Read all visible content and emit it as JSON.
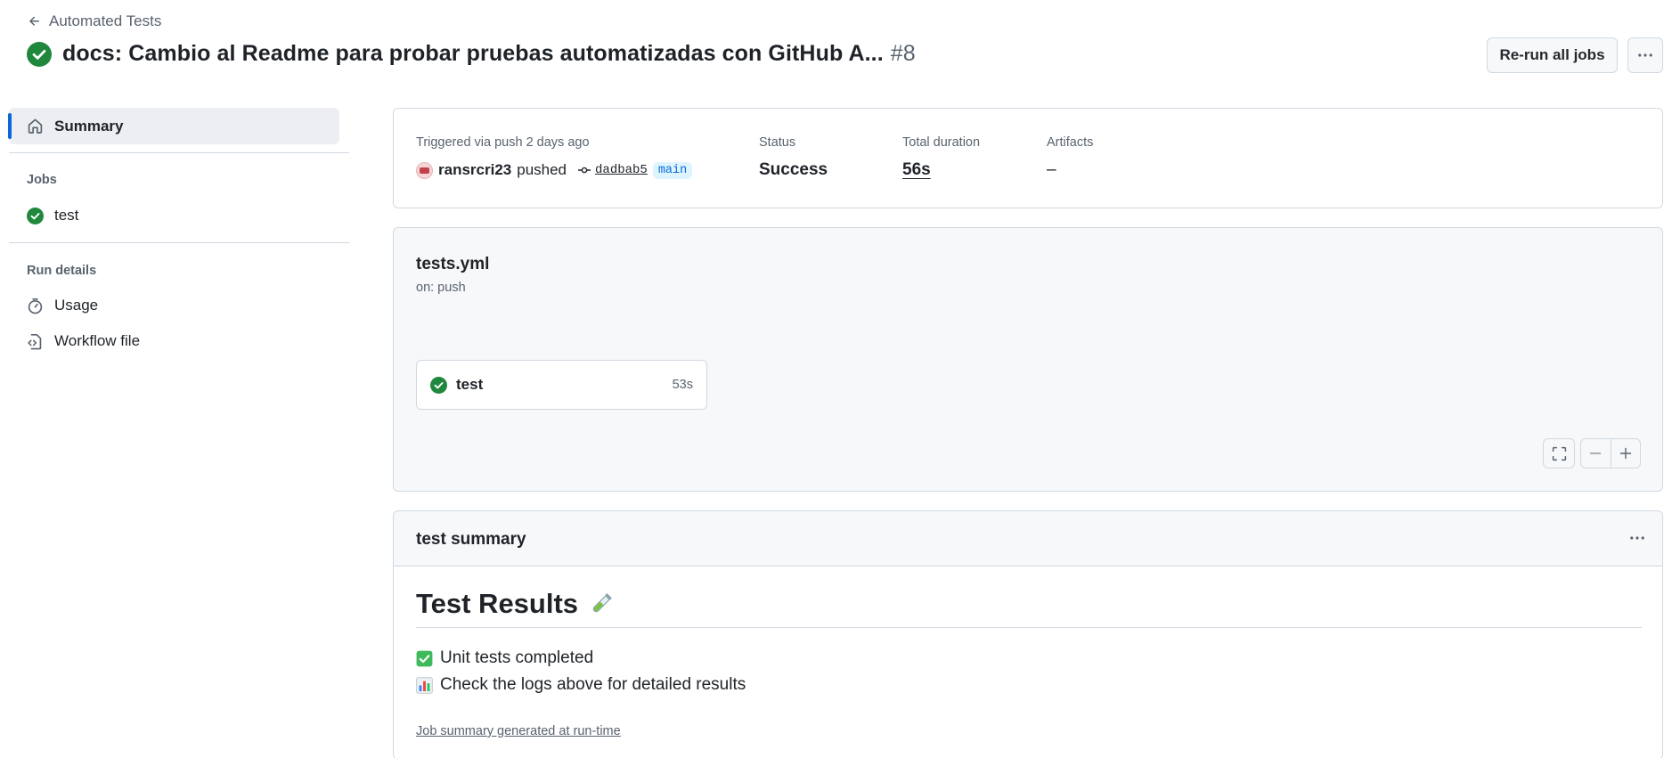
{
  "header": {
    "back_label": "Automated Tests",
    "title": "docs: Cambio al Readme para probar pruebas automatizadas con GitHub A...",
    "run_number": "#8",
    "rerun_label": "Re-run all jobs"
  },
  "sidebar": {
    "summary_label": "Summary",
    "jobs_heading": "Jobs",
    "jobs": [
      {
        "label": "test",
        "status": "success"
      }
    ],
    "run_details_heading": "Run details",
    "details": [
      {
        "label": "Usage",
        "icon": "stopwatch-icon"
      },
      {
        "label": "Workflow file",
        "icon": "file-code-icon"
      }
    ]
  },
  "run_meta": {
    "trigger_label": "Triggered via push 2 days ago",
    "actor": "ransrcri23",
    "action": "pushed",
    "commit": "dadbab5",
    "branch": "main",
    "status_label": "Status",
    "status_value": "Success",
    "duration_label": "Total duration",
    "duration_value": "56s",
    "artifacts_label": "Artifacts",
    "artifacts_value": "–"
  },
  "workflow": {
    "file": "tests.yml",
    "trigger": "on: push",
    "jobs": [
      {
        "name": "test",
        "duration": "53s"
      }
    ]
  },
  "summary": {
    "title": "test summary",
    "heading": "Test Results",
    "lines": [
      "Unit tests completed",
      "Check the logs above for detailed results"
    ],
    "footnote": "Job summary generated at run-time"
  },
  "colors": {
    "success": "#1f883d",
    "accent": "#0969da",
    "muted": "#59636e",
    "border": "#d1d9e0"
  }
}
